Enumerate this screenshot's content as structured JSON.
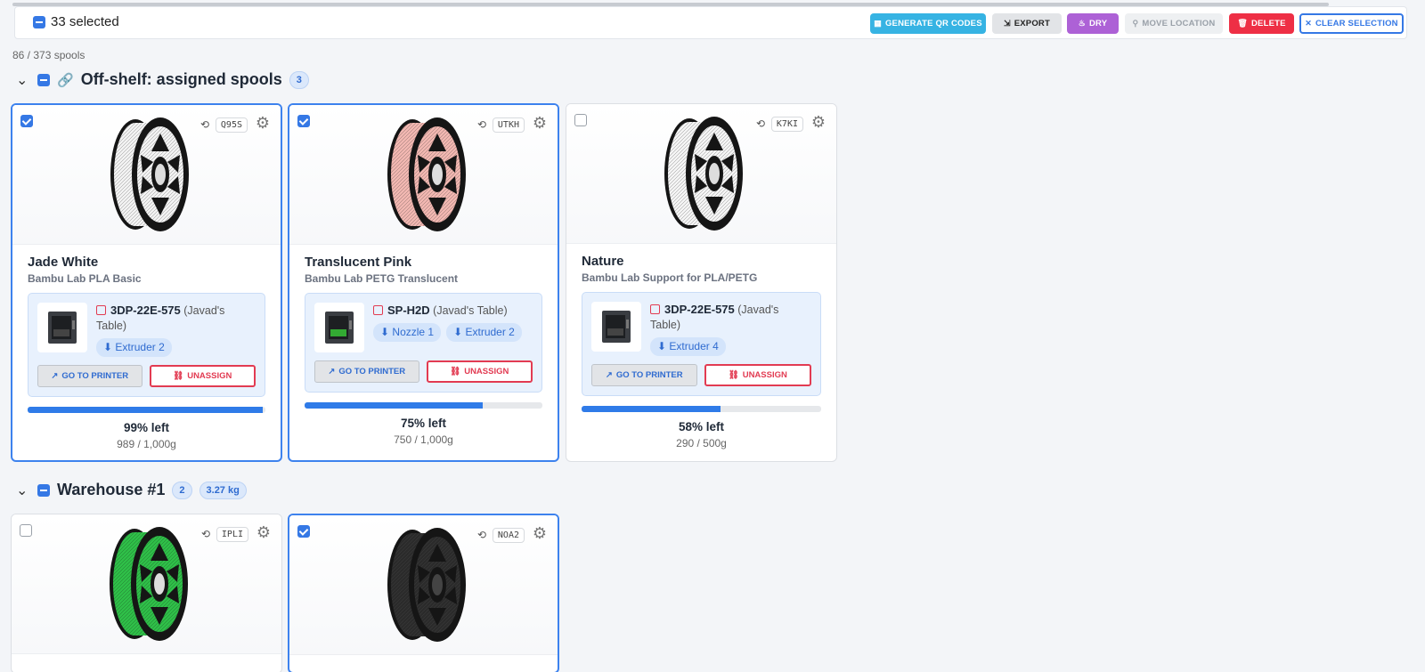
{
  "toolbar": {
    "selected_label": "33 selected",
    "buttons": {
      "qr": "GENERATE QR CODES",
      "export": "EXPORT",
      "dry": "DRY",
      "move": "MOVE LOCATION",
      "delete": "DELETE",
      "clear": "CLEAR SELECTION"
    }
  },
  "spool_count": "86 / 373 spools",
  "groups": [
    {
      "title": "Off-shelf: assigned spools",
      "count": "3"
    },
    {
      "title": "Warehouse #1",
      "count": "2",
      "weight": "3.27 kg"
    }
  ],
  "cards": [
    {
      "code": "Q95S",
      "selected": true,
      "color": "#f2f2f2",
      "name": "Jade White",
      "material": "Bambu Lab PLA Basic",
      "printer_code": "3DP-22E-575",
      "printer_loc": "(Javad's Table)",
      "chips": [
        "Extruder 2"
      ],
      "go_label": "GO TO PRINTER",
      "unassign_label": "UNASSIGN",
      "remaining_fraction": 0.99,
      "pct_label": "99% left",
      "weight_label": "989 / 1,000g"
    },
    {
      "code": "UTKH",
      "selected": true,
      "color": "#f1b7b1",
      "name": "Translucent Pink",
      "material": "Bambu Lab PETG Translucent",
      "printer_code": "SP-H2D",
      "printer_loc": "(Javad's Table)",
      "chips": [
        "Nozzle 1",
        "Extruder 2"
      ],
      "go_label": "GO TO PRINTER",
      "unassign_label": "UNASSIGN",
      "remaining_fraction": 0.75,
      "pct_label": "75% left",
      "weight_label": "750 / 1,000g"
    },
    {
      "code": "K7KI",
      "selected": false,
      "color": "#f4f4f4",
      "name": "Nature",
      "material": "Bambu Lab Support for PLA/PETG",
      "printer_code": "3DP-22E-575",
      "printer_loc": "(Javad's Table)",
      "chips": [
        "Extruder 4"
      ],
      "go_label": "GO TO PRINTER",
      "unassign_label": "UNASSIGN",
      "remaining_fraction": 0.58,
      "pct_label": "58% left",
      "weight_label": "290 / 500g"
    },
    {
      "code": "IPLI",
      "selected": false,
      "color": "#2fbf48"
    },
    {
      "code": "NOA2",
      "selected": true,
      "color": "#2b2b2b"
    }
  ]
}
